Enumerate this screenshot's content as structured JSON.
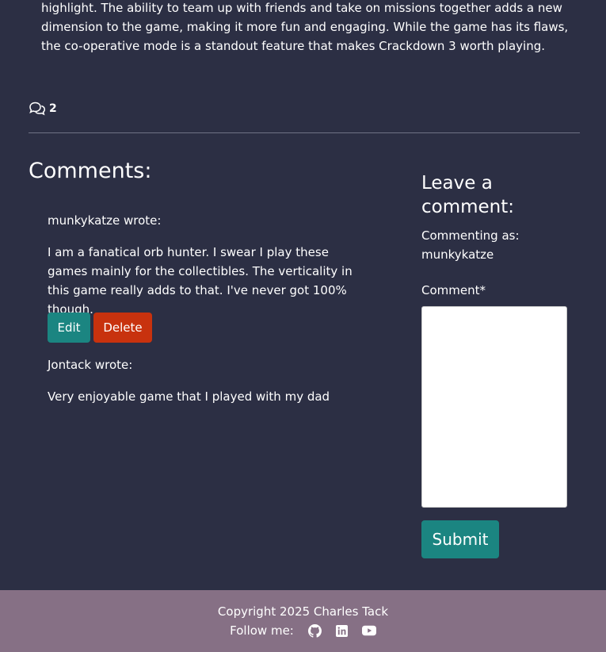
{
  "article": {
    "text": "highlight. The ability to team up with friends and take on missions together adds a new dimension to the game, making it more fun and engaging. While the game has its flaws, the co-operative mode is a standout feature that makes Crackdown 3 worth playing."
  },
  "meta": {
    "comment_count": "2",
    "comment_icon": "comments-icon"
  },
  "comments": {
    "heading": "Comments:",
    "items": [
      {
        "author": "munkykatze wrote:",
        "body": "I am a fanatical orb hunter. I swear I play these games mainly for the collectibles. The verticality in this game really adds to that. I've never got 100% though.",
        "edit_label": "Edit",
        "delete_label": "Delete"
      },
      {
        "author": "Jontack wrote:",
        "body": "Very enjoyable game that I played with my dad"
      }
    ]
  },
  "form": {
    "heading": "Leave a comment:",
    "commenting_as_label": "Commenting as:",
    "username": "munkykatze",
    "comment_label": "Comment*",
    "comment_value": "",
    "submit_label": "Submit"
  },
  "footer": {
    "copyright": "Copyright 2025 Charles Tack",
    "follow_label": "Follow me:",
    "socials": [
      "github-icon",
      "linkedin-icon",
      "youtube-icon"
    ]
  },
  "colors": {
    "background": "#2c2f44",
    "accent": "#1b8581",
    "danger": "#c8320e",
    "footer": "#867085"
  }
}
